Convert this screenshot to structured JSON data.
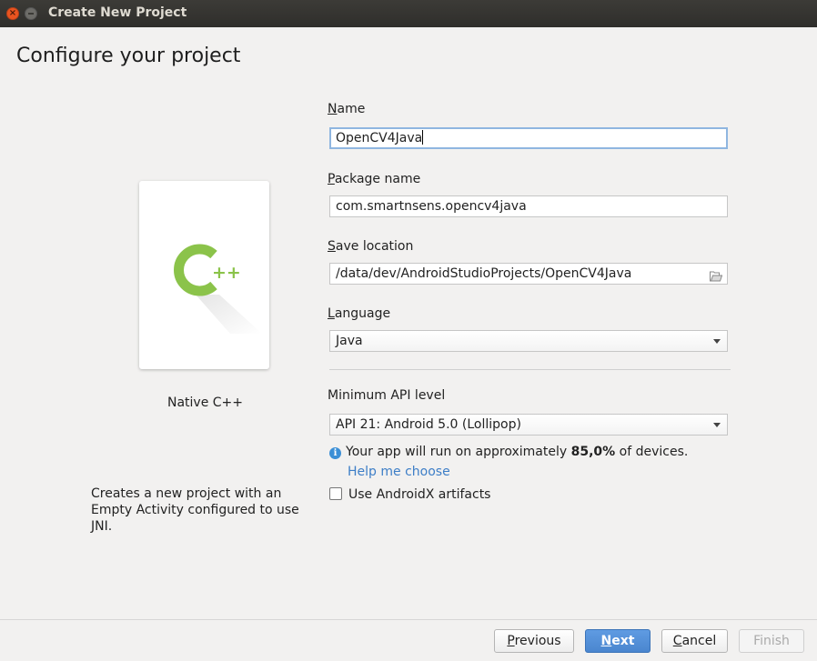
{
  "window": {
    "title": "Create New Project"
  },
  "page": {
    "heading": "Configure your project"
  },
  "template": {
    "name": "Native C++",
    "icon_text": "++",
    "description": "Creates a new project with an Empty Activity configured to use JNI."
  },
  "form": {
    "name": {
      "label_mnemonic": "N",
      "label_rest": "ame",
      "value": "OpenCV4Java"
    },
    "package": {
      "label_mnemonic": "P",
      "label_rest": "ackage name",
      "value": "com.smartnsens.opencv4java"
    },
    "location": {
      "label_mnemonic": "S",
      "label_rest": "ave location",
      "value": "/data/dev/AndroidStudioProjects/OpenCV4Java"
    },
    "language": {
      "label_mnemonic": "L",
      "label_rest": "anguage",
      "value": "Java"
    },
    "min_api": {
      "label": "Minimum API level",
      "value": "API 21: Android 5.0 (Lollipop)"
    },
    "info": {
      "prefix": "Your app will run on approximately ",
      "percent": "85,0%",
      "suffix": " of devices."
    },
    "help_link": "Help me choose",
    "androidx": {
      "label": "Use AndroidX artifacts",
      "checked": false
    }
  },
  "buttons": {
    "previous": {
      "mnemonic": "P",
      "rest": "revious"
    },
    "next": {
      "mnemonic": "N",
      "rest": "ext"
    },
    "cancel": {
      "mnemonic": "C",
      "rest": "ancel"
    },
    "finish": {
      "label": "Finish"
    }
  },
  "colors": {
    "accent": "#4a86cf",
    "cpp_logo": "#8bc34a",
    "link": "#3d7ec7",
    "close_button": "#e95420"
  },
  "icons": {
    "folder": "folder-open-icon",
    "info": "info-icon",
    "dropdown": "chevron-down-icon"
  }
}
